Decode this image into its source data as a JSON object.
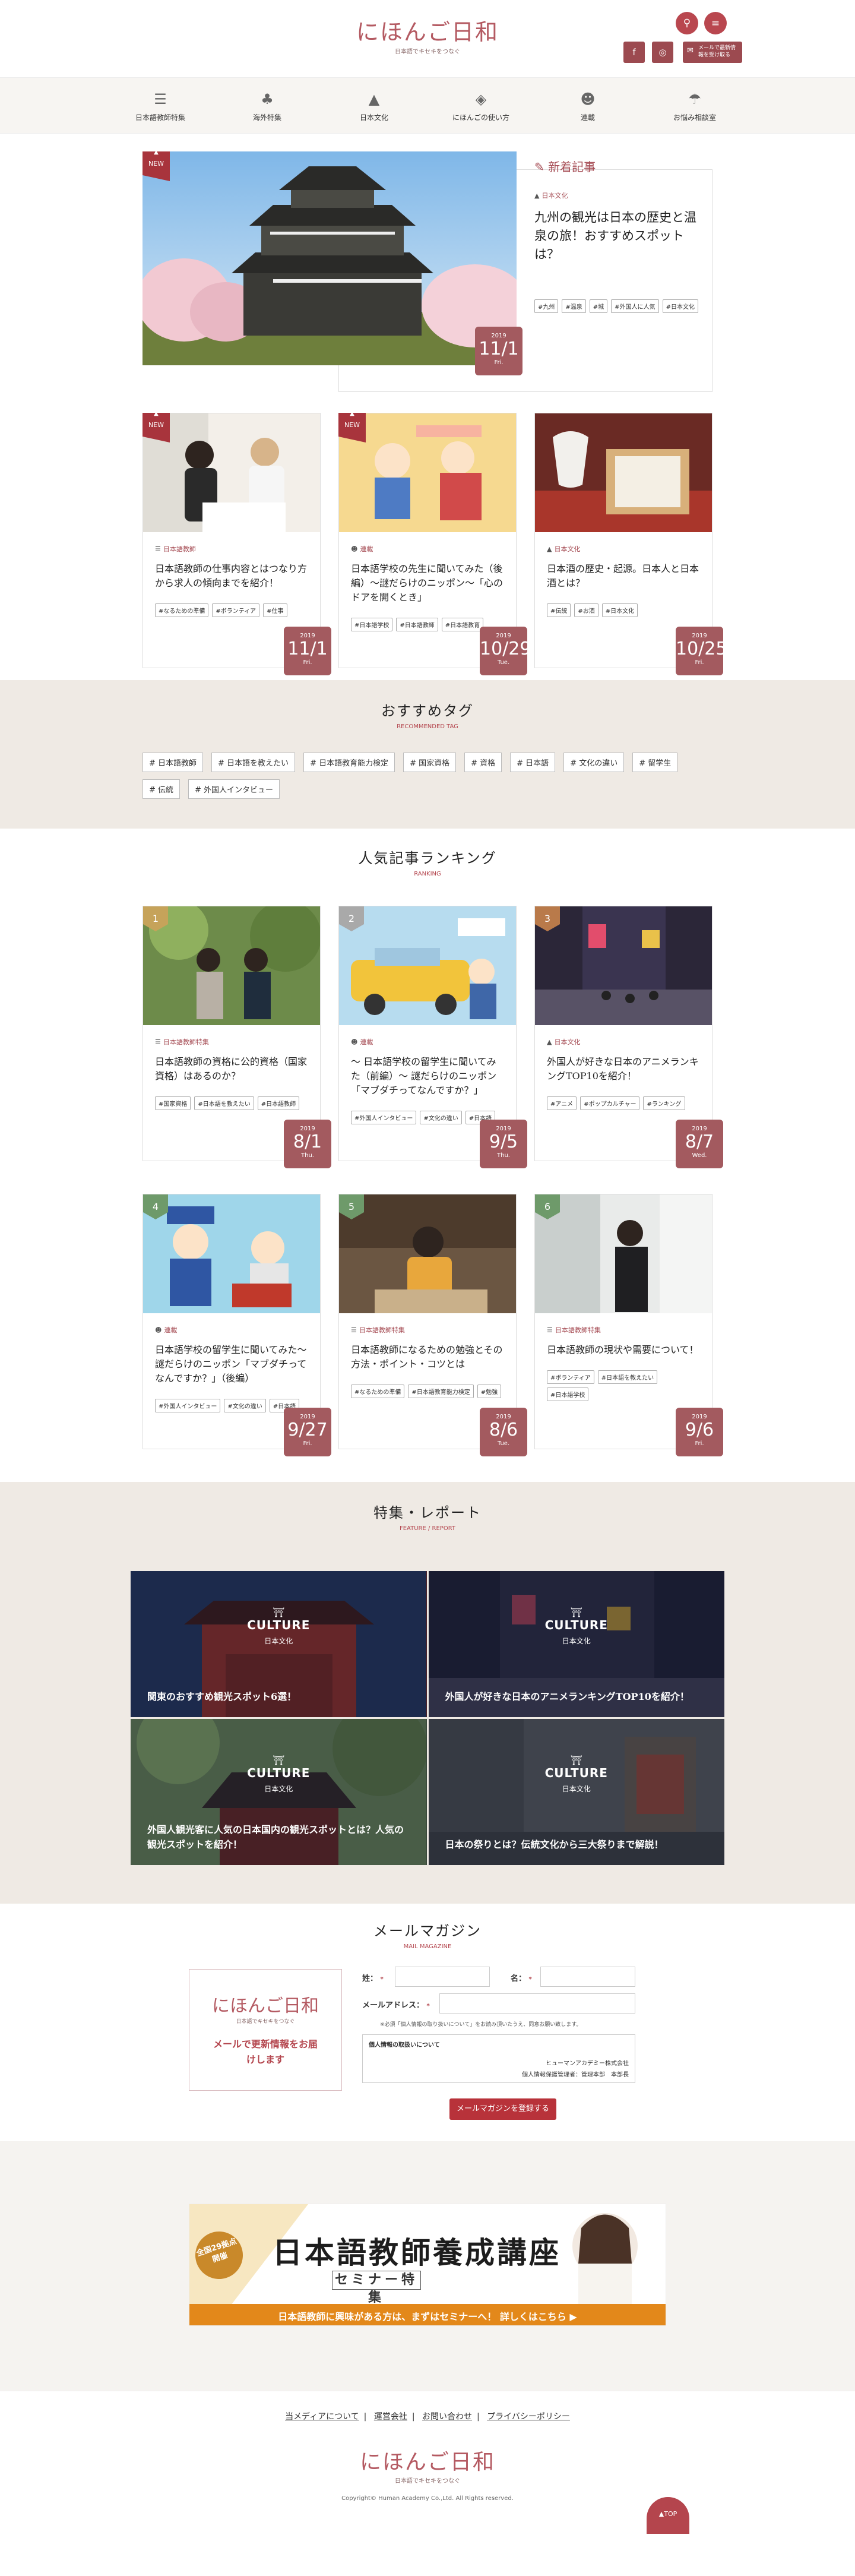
{
  "site": {
    "logo": "にほんご日和",
    "tagline": "日本語でキセキをつなぐ"
  },
  "header": {
    "search_icon": "search-icon",
    "menu_icon": "menu-icon",
    "mail_button": "メールで最新情報を受け取る"
  },
  "nav": [
    {
      "label": "日本語教師特集",
      "icon": "books-icon"
    },
    {
      "label": "海外特集",
      "icon": "tree-icon"
    },
    {
      "label": "日本文化",
      "icon": "mountain-icon"
    },
    {
      "label": "にほんごの使い方",
      "icon": "diamond-icon"
    },
    {
      "label": "連載",
      "icon": "people-icon"
    },
    {
      "label": "お悩み相談室",
      "icon": "umbrella-icon"
    }
  ],
  "new_label": "NEW",
  "new_articles_heading": "新着記事",
  "featured": {
    "category": "日本文化",
    "title": "九州の観光は日本の歴史と温泉の旅！おすすめスポットは？",
    "tags": [
      "#九州",
      "#温泉",
      "#城",
      "#外国人に人気",
      "#日本文化"
    ],
    "date": {
      "year": "2019",
      "day": "11/1",
      "weekday": "Fri."
    }
  },
  "new_cards": [
    {
      "category": "日本語教師",
      "title": "日本語教師の仕事内容とはつなり方から求人の傾向までを紹介！",
      "tags": [
        "#なるための準備",
        "#ボランティア",
        "#仕事"
      ],
      "date": {
        "year": "2019",
        "day": "11/1",
        "weekday": "Fri."
      },
      "new": true
    },
    {
      "category": "連載",
      "title": "日本語学校の先生に聞いてみた（後編）〜謎だらけのニッポン〜「心のドアを開くとき」",
      "tags": [
        "#日本語学校",
        "#日本語教師",
        "#日本語教育"
      ],
      "date": {
        "year": "2019",
        "day": "10/29",
        "weekday": "Tue."
      },
      "new": true
    },
    {
      "category": "日本文化",
      "title": "日本酒の歴史・起源。日本人と日本酒とは？",
      "tags": [
        "#伝統",
        "#お酒",
        "#日本文化"
      ],
      "date": {
        "year": "2019",
        "day": "10/25",
        "weekday": "Fri."
      },
      "new": false
    }
  ],
  "recommended": {
    "title": "おすすめタグ",
    "subtitle": "RECOMMENDED TAG",
    "tags": [
      "# 日本語教師",
      "# 日本語を教えたい",
      "# 日本語教育能力検定",
      "# 国家資格",
      "# 資格",
      "# 日本語",
      "# 文化の違い",
      "# 留学生",
      "# 伝統",
      "# 外国人インタビュー"
    ]
  },
  "ranking": {
    "title": "人気記事ランキング",
    "subtitle": "RANKING",
    "cards": [
      {
        "rank": "1",
        "category": "日本語教師特集",
        "title": "日本語教師の資格に公的資格（国家資格）はあるのか？",
        "tags": [
          "#国家資格",
          "#日本語を教えたい",
          "#日本語教師"
        ],
        "date": {
          "year": "2019",
          "day": "8/1",
          "weekday": "Thu."
        }
      },
      {
        "rank": "2",
        "category": "連載",
        "title": "〜 日本語学校の留学生に聞いてみた（前編）〜 謎だらけのニッポン「マブダチってなんですか？」",
        "tags": [
          "#外国人インタビュー",
          "#文化の違い",
          "#日本語"
        ],
        "date": {
          "year": "2019",
          "day": "9/5",
          "weekday": "Thu."
        }
      },
      {
        "rank": "3",
        "category": "日本文化",
        "title": "外国人が好きな日本のアニメランキングTOP10を紹介！",
        "tags": [
          "#アニメ",
          "#ポップカルチャー",
          "#ランキング"
        ],
        "date": {
          "year": "2019",
          "day": "8/7",
          "weekday": "Wed."
        }
      },
      {
        "rank": "4",
        "category": "連載",
        "title": "日本語学校の留学生に聞いてみた〜謎だらけのニッポン「マブダチってなんですか？」（後編）",
        "tags": [
          "#外国人インタビュー",
          "#文化の違い",
          "#日本語"
        ],
        "date": {
          "year": "2019",
          "day": "9/27",
          "weekday": "Fri."
        }
      },
      {
        "rank": "5",
        "category": "日本語教師特集",
        "title": "日本語教師になるための勉強とその方法・ポイント・コツとは",
        "tags": [
          "#なるための準備",
          "#日本語教育能力検定",
          "#勉強"
        ],
        "date": {
          "year": "2019",
          "day": "8/6",
          "weekday": "Tue."
        }
      },
      {
        "rank": "6",
        "category": "日本語教師特集",
        "title": "日本語教師の現状や需要について！",
        "tags": [
          "#ボランティア",
          "#日本語を教えたい",
          "#日本語学校"
        ],
        "date": {
          "year": "2019",
          "day": "9/6",
          "weekday": "Fri."
        }
      }
    ]
  },
  "features": {
    "title": "特集・レポート",
    "subtitle": "FEATURE / REPORT",
    "items": [
      {
        "label": "CULTURE",
        "category": "日本文化",
        "title": "関東のおすすめ観光スポット6選！"
      },
      {
        "label": "CULTURE",
        "category": "日本文化",
        "title": "外国人が好きな日本のアニメランキングTOP10を紹介！"
      },
      {
        "label": "CULTURE",
        "category": "日本文化",
        "title": "外国人観光客に人気の日本国内の観光スポットとは？人気の観光スポットを紹介！"
      },
      {
        "label": "CULTURE",
        "category": "日本文化",
        "title": "日本の祭りとは？伝統文化から三大祭りまで解説！"
      }
    ]
  },
  "mail": {
    "title": "メールマガジン",
    "subtitle": "MAIL MAGAZINE",
    "box_logo": "にほんご日和",
    "box_tagline": "日本語でキセキをつなぐ",
    "box_text": "メールで更新情報をお届けします",
    "last_name": "姓：",
    "first_name": "名：",
    "email_label": "メールアドレス：",
    "required": "*",
    "note": "※必須「個人情報の取り扱いについて」をお読み頂いたうえ、同意お願い致します。",
    "privacy_title": "個人情報の取扱いについて",
    "company": "ヒューマンアカデミー株式会社",
    "manager": "個人情報保護管理者：管理本部　本部長",
    "submit": "メールマガジンを登録する"
  },
  "banner": {
    "badge": "全国29拠点開催",
    "title": "日本語教師養成講座",
    "subtitle": "セミナー特集",
    "strip": "日本語教師に興味がある方は、まずはセミナーへ！ 詳しくはこちら ▶"
  },
  "footer": {
    "links": [
      "当メディアについて",
      "運営会社",
      "お問い合わせ",
      "プライバシーポリシー"
    ],
    "copyright": "Copyright© Human Academy Co.,Ltd. All Rights reserved.",
    "top": "TOP"
  }
}
